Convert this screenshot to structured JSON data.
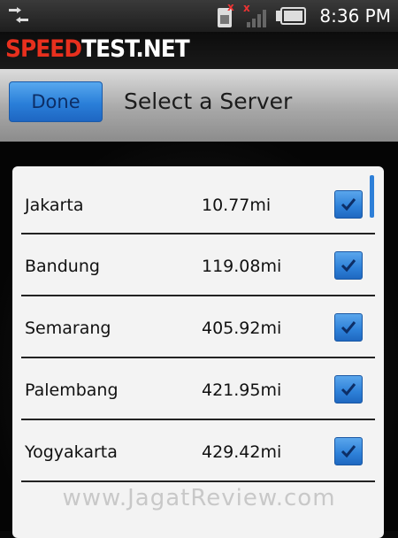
{
  "status_bar": {
    "time": "8:36 PM",
    "icons": [
      "usb-icon",
      "sim-card-icon",
      "no-signal-icon",
      "battery-icon"
    ]
  },
  "logo": {
    "part1": "SPEED",
    "part2": "TEST.NET"
  },
  "header": {
    "done_label": "Done",
    "title": "Select a Server"
  },
  "servers": [
    {
      "name": "Jakarta",
      "distance": "10.77mi",
      "checked": true
    },
    {
      "name": "Bandung",
      "distance": "119.08mi",
      "checked": true
    },
    {
      "name": "Semarang",
      "distance": "405.92mi",
      "checked": true
    },
    {
      "name": "Palembang",
      "distance": "421.95mi",
      "checked": true
    },
    {
      "name": "Yogyakarta",
      "distance": "429.42mi",
      "checked": true
    }
  ],
  "colors": {
    "accent": "#2d80d8",
    "logo_red": "#e8301e"
  },
  "watermark": "www.JagatReview.com"
}
